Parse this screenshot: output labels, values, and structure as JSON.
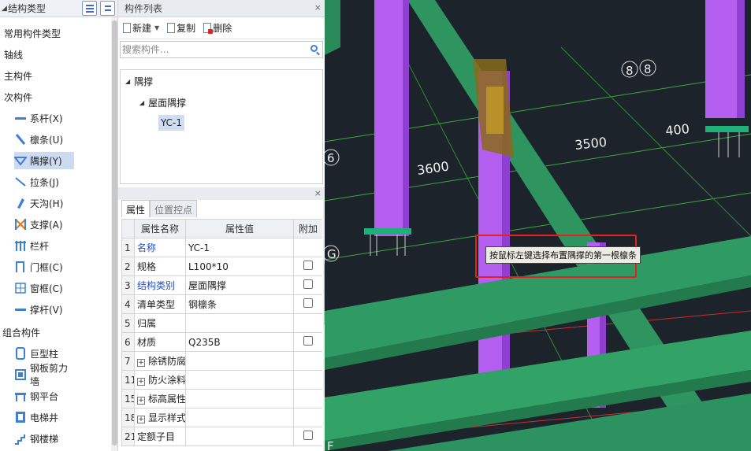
{
  "left_panel": {
    "title": "结构类型",
    "categories": [
      {
        "label": "常用构件类型"
      },
      {
        "label": "轴线"
      },
      {
        "label": "主构件"
      },
      {
        "label": "次构件"
      }
    ],
    "sub_items": [
      {
        "label": "系杆(X)",
        "icon": "tie-rod-icon"
      },
      {
        "label": "檩条(U)",
        "icon": "purlin-icon"
      },
      {
        "label": "隅撑(Y)",
        "icon": "knee-brace-icon",
        "selected": true
      },
      {
        "label": "拉条(J)",
        "icon": "sag-rod-icon"
      },
      {
        "label": "天沟(H)",
        "icon": "gutter-icon"
      },
      {
        "label": "支撑(A)",
        "icon": "bracing-icon"
      },
      {
        "label": "栏杆",
        "icon": "railing-icon"
      },
      {
        "label": "门框(C)",
        "icon": "door-frame-icon"
      },
      {
        "label": "窗框(C)",
        "icon": "window-frame-icon"
      },
      {
        "label": "撑杆(V)",
        "icon": "strut-icon"
      }
    ],
    "group_category": "组合构件",
    "group_items": [
      {
        "label": "巨型柱",
        "icon": "mega-column-icon"
      },
      {
        "label": "钢板剪力墙",
        "icon": "shear-wall-icon"
      },
      {
        "label": "钢平台",
        "icon": "steel-platform-icon"
      },
      {
        "label": "电梯井",
        "icon": "elevator-shaft-icon"
      },
      {
        "label": "钢楼梯",
        "icon": "steel-stair-icon"
      }
    ]
  },
  "component_list": {
    "title": "构件列表",
    "toolbar": {
      "new_label": "新建",
      "copy_label": "复制",
      "delete_label": "删除"
    },
    "search_placeholder": "搜索构件...",
    "tree": {
      "root": "隅撑",
      "child": "屋面隅撑",
      "leaf": "YC-1"
    }
  },
  "properties": {
    "tab_attr": "属性",
    "tab_position": "位置控点",
    "headers": {
      "name": "属性名称",
      "value": "属性值",
      "extra": "附加"
    },
    "rows": [
      {
        "num": "1",
        "name": "名称",
        "value": "YC-1",
        "blue": true,
        "checkbox": false,
        "expand": false
      },
      {
        "num": "2",
        "name": "规格",
        "value": "L100*10",
        "blue": false,
        "checkbox": true,
        "expand": false
      },
      {
        "num": "3",
        "name": "结构类别",
        "value": "屋面隅撑",
        "blue": true,
        "checkbox": true,
        "expand": false
      },
      {
        "num": "4",
        "name": "清单类型",
        "value": "钢檩条",
        "blue": false,
        "checkbox": true,
        "expand": false
      },
      {
        "num": "5",
        "name": "归属",
        "value": "",
        "blue": false,
        "checkbox": false,
        "expand": false
      },
      {
        "num": "6",
        "name": "材质",
        "value": "Q235B",
        "blue": false,
        "checkbox": true,
        "expand": false
      },
      {
        "num": "7",
        "name": "除锈防腐",
        "value": "",
        "blue": false,
        "checkbox": false,
        "expand": true
      },
      {
        "num": "11",
        "name": "防火涂料",
        "value": "",
        "blue": false,
        "checkbox": false,
        "expand": true
      },
      {
        "num": "15",
        "name": "标高属性",
        "value": "",
        "blue": false,
        "checkbox": false,
        "expand": true
      },
      {
        "num": "18",
        "name": "显示样式",
        "value": "",
        "blue": false,
        "checkbox": false,
        "expand": true
      },
      {
        "num": "21",
        "name": "定额子目",
        "value": "",
        "blue": false,
        "checkbox": true,
        "expand": false
      }
    ]
  },
  "viewport": {
    "dimensions": [
      "3600",
      "3500",
      "400"
    ],
    "axis_labels": [
      "8",
      "8",
      "6",
      "G",
      "F"
    ],
    "tooltip": "按鼠标左键选择布置隅撑的第一根檩条",
    "colors": {
      "background": "#1d232b",
      "beam": "#2f9a63",
      "column": "#b45ff0",
      "grid": "#3aa83f",
      "highlight": "#e61f1f"
    }
  }
}
